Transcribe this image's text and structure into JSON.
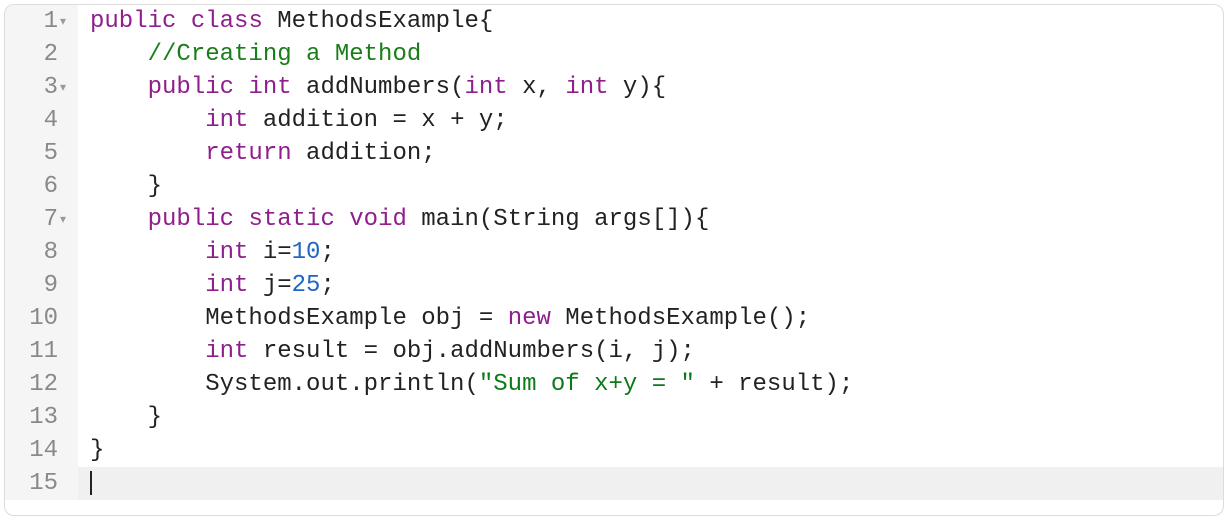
{
  "lines": [
    {
      "n": "1",
      "fold": "▾"
    },
    {
      "n": "2",
      "fold": ""
    },
    {
      "n": "3",
      "fold": "▾"
    },
    {
      "n": "4",
      "fold": ""
    },
    {
      "n": "5",
      "fold": ""
    },
    {
      "n": "6",
      "fold": ""
    },
    {
      "n": "7",
      "fold": "▾"
    },
    {
      "n": "8",
      "fold": ""
    },
    {
      "n": "9",
      "fold": ""
    },
    {
      "n": "10",
      "fold": ""
    },
    {
      "n": "11",
      "fold": ""
    },
    {
      "n": "12",
      "fold": ""
    },
    {
      "n": "13",
      "fold": ""
    },
    {
      "n": "14",
      "fold": ""
    },
    {
      "n": "15",
      "fold": ""
    }
  ],
  "code": {
    "l1": {
      "kw1": "public ",
      "kw2": "class ",
      "id": "MethodsExample",
      "p": "{"
    },
    "l2": {
      "indent": "    ",
      "cmt": "//Creating a Method"
    },
    "l3": {
      "indent": "    ",
      "kw1": "public ",
      "kw2": "int ",
      "id": "addNumbers",
      "p1": "(",
      "kw3": "int ",
      "id2": "x",
      "p2": ", ",
      "kw4": "int ",
      "id3": "y",
      "p3": "){"
    },
    "l4": {
      "indent": "        ",
      "kw1": "int ",
      "id": "addition ",
      "p1": "= x + y;"
    },
    "l5": {
      "indent": "        ",
      "kw1": "return ",
      "id": "addition",
      "p": ";"
    },
    "l6": {
      "indent": "    ",
      "p": "}"
    },
    "l7": {
      "indent": "    ",
      "kw1": "public ",
      "kw2": "static ",
      "kw3": "void ",
      "id": "main",
      "p1": "(",
      "id2": "String args",
      "p2": "[]){"
    },
    "l8": {
      "indent": "        ",
      "kw1": "int ",
      "id": "i",
      "p1": "=",
      "num": "10",
      "p2": ";"
    },
    "l9": {
      "indent": "        ",
      "kw1": "int ",
      "id": "j",
      "p1": "=",
      "num": "25",
      "p2": ";"
    },
    "l10": {
      "indent": "        ",
      "id1": "MethodsExample obj ",
      "p1": "= ",
      "kw1": "new ",
      "id2": "MethodsExample",
      "p2": "();"
    },
    "l11": {
      "indent": "        ",
      "kw1": "int ",
      "id": "result ",
      "p1": "= obj.addNumbers(i, j);"
    },
    "l12": {
      "indent": "        ",
      "id": "System.out.println",
      "p1": "(",
      "str": "\"Sum of x+y = \"",
      "p2": " + result);"
    },
    "l13": {
      "indent": "    ",
      "p": "}"
    },
    "l14": {
      "p": "}"
    }
  }
}
